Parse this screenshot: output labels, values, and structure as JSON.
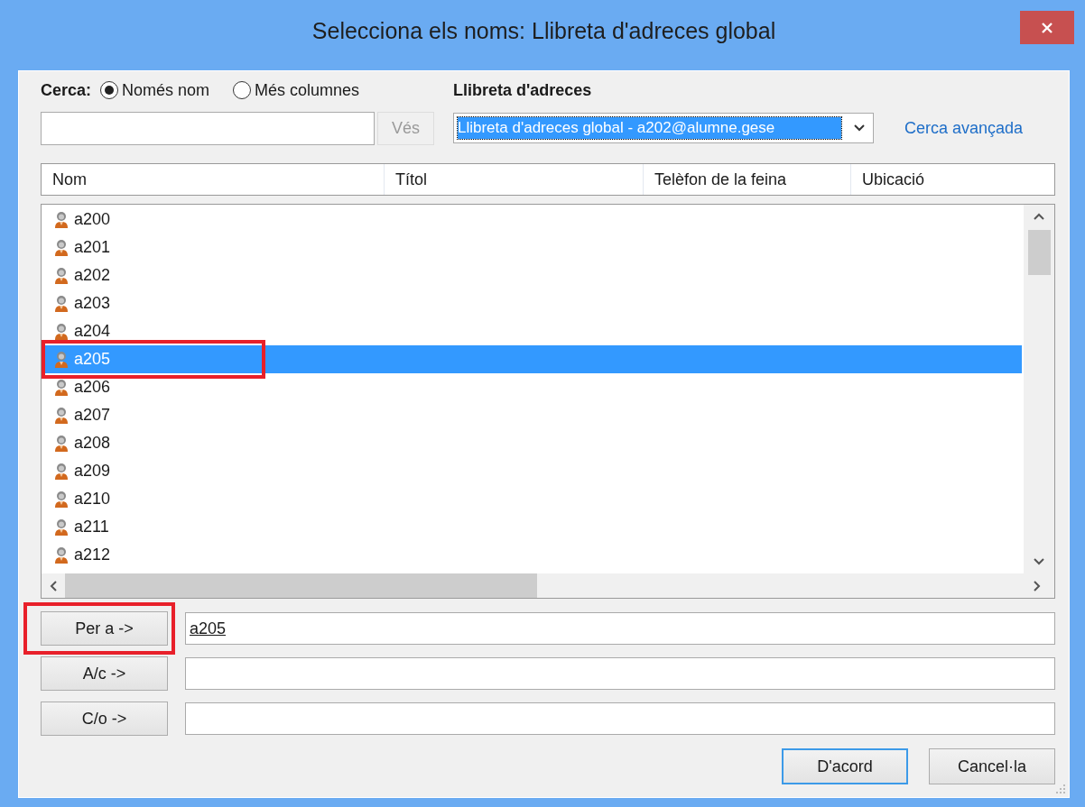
{
  "window": {
    "title": "Selecciona els noms: Llibreta d'adreces global"
  },
  "search": {
    "label": "Cerca:",
    "options": [
      {
        "label": "Només nom",
        "selected": true
      },
      {
        "label": "Més columnes",
        "selected": false
      }
    ],
    "go_button": {
      "label": "Vés",
      "disabled": true
    }
  },
  "address_book": {
    "label": "Llibreta d'adreces",
    "selected": "Llibreta d'adreces global - a202@alumne.gese",
    "advanced_link": "Cerca avançada"
  },
  "table": {
    "columns": [
      "Nom",
      "Títol",
      "Telèfon de la feina",
      "Ubicació"
    ],
    "rows": [
      {
        "name": "a200",
        "selected": false,
        "marked": false
      },
      {
        "name": "a201",
        "selected": false,
        "marked": false
      },
      {
        "name": "a202",
        "selected": false,
        "marked": false
      },
      {
        "name": "a203",
        "selected": false,
        "marked": false
      },
      {
        "name": "a204",
        "selected": false,
        "marked": false
      },
      {
        "name": "a205",
        "selected": true,
        "marked": true
      },
      {
        "name": "a206",
        "selected": false,
        "marked": false
      },
      {
        "name": "a207",
        "selected": false,
        "marked": false
      },
      {
        "name": "a208",
        "selected": false,
        "marked": false
      },
      {
        "name": "a209",
        "selected": false,
        "marked": false
      },
      {
        "name": "a210",
        "selected": false,
        "marked": false
      },
      {
        "name": "a211",
        "selected": false,
        "marked": false
      },
      {
        "name": "a212",
        "selected": false,
        "marked": false
      }
    ]
  },
  "recipients": [
    {
      "button": "Per a ->",
      "value": "a205",
      "marked": true
    },
    {
      "button": "A/c ->",
      "marked": false
    },
    {
      "button": "C/o ->",
      "marked": false
    }
  ],
  "buttons": [
    {
      "label": "D'acord",
      "default": true
    },
    {
      "label": "Cancel·la",
      "default": false
    }
  ]
}
